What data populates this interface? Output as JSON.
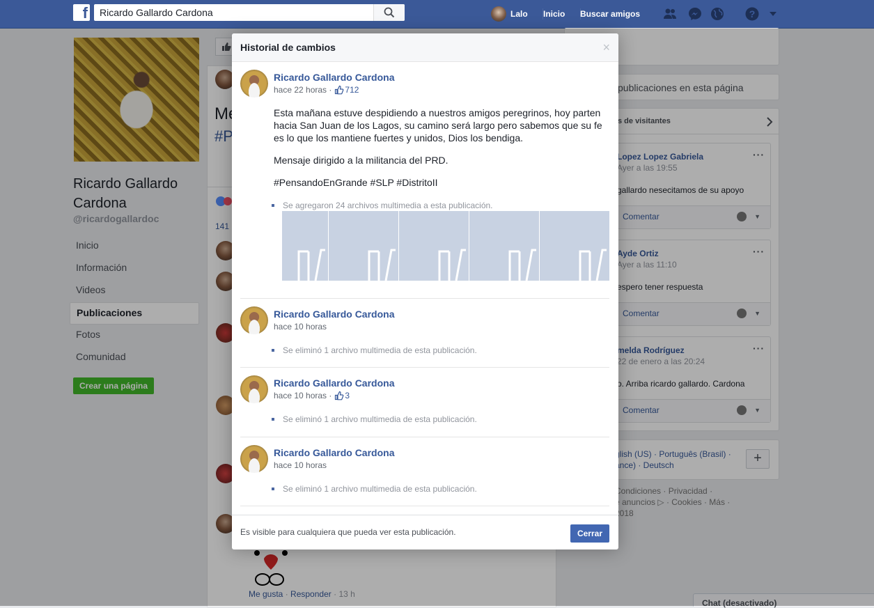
{
  "topbar": {
    "search_value": "Ricardo Gallardo Cardona",
    "user_name": "Lalo",
    "home": "Inicio",
    "find_friends": "Buscar amigos"
  },
  "profile": {
    "name": "Ricardo Gallardo Cardona",
    "handle": "@ricardogallardoc",
    "nav": [
      "Inicio",
      "Información",
      "Videos",
      "Publicaciones",
      "Fotos",
      "Comunidad"
    ],
    "create_page": "Crear una página"
  },
  "middle": {
    "partial_title": "Me",
    "partial_hashtag": "#P",
    "partial_count": "141",
    "comment_like": "Me gusta",
    "comment_reply": "Responder",
    "comment_time": "· 13 h"
  },
  "right": {
    "search_posts": "publicaciones en esta página",
    "visitors_header": "s de visitantes",
    "visitors": [
      {
        "name": "Lopez Lopez Gabriela",
        "time": "Ayer a las 19:55",
        "text": "gallardo nesecitamos de su apoyo",
        "comment": "Comentar"
      },
      {
        "name": "Ayde Ortiz",
        "time": "Ayer a las 11:10",
        "text": "espero tener respuesta",
        "comment": "Comentar"
      },
      {
        "name": "melda Rodríguez",
        "time": "22 de enero a las 20:24",
        "text": "o. Arriba ricardo gallardo. Cardona",
        "comment": "Comentar"
      }
    ],
    "languages_line1": "glish (US) · Português (Brasil) ·",
    "languages_line2": "ance) · Deutsch",
    "footer_line1": "Condiciones · Privacidad ·",
    "footer_line2": "e anuncios ▷ · Cookies · Más ·",
    "footer_line3": "2018",
    "chat": "Chat (desactivado)"
  },
  "modal": {
    "title": "Historial de cambios",
    "close_icon": "×",
    "entries": [
      {
        "author": "Ricardo Gallardo Cardona",
        "time": "hace 22 horas ·",
        "likes": "712",
        "paragraph1": "Esta mañana estuve despidiendo a nuestros amigos peregrinos, hoy parten hacia San Juan de los Lagos, su camino será largo pero sabemos que su fe es lo que los mantiene fuertes y unidos, Dios los bendiga.",
        "paragraph2": "Mensaje dirigido a la militancia del PRD.",
        "paragraph3": "#PensandoEnGrande #SLP #DistritoII",
        "change": "Se agregaron 24 archivos multimedia a esta publicación."
      },
      {
        "author": "Ricardo Gallardo Cardona",
        "time": "hace 10 horas",
        "change": "Se eliminó 1 archivo multimedia de esta publicación."
      },
      {
        "author": "Ricardo Gallardo Cardona",
        "time": "hace 10 horas ·",
        "likes": "3",
        "change": "Se eliminó 1 archivo multimedia de esta publicación."
      },
      {
        "author": "Ricardo Gallardo Cardona",
        "time": "hace 10 horas",
        "change": "Se eliminó 1 archivo multimedia de esta publicación."
      }
    ],
    "footer_text": "Es visible para cualquiera que pueda ver esta publicación.",
    "close_button": "Cerrar"
  }
}
